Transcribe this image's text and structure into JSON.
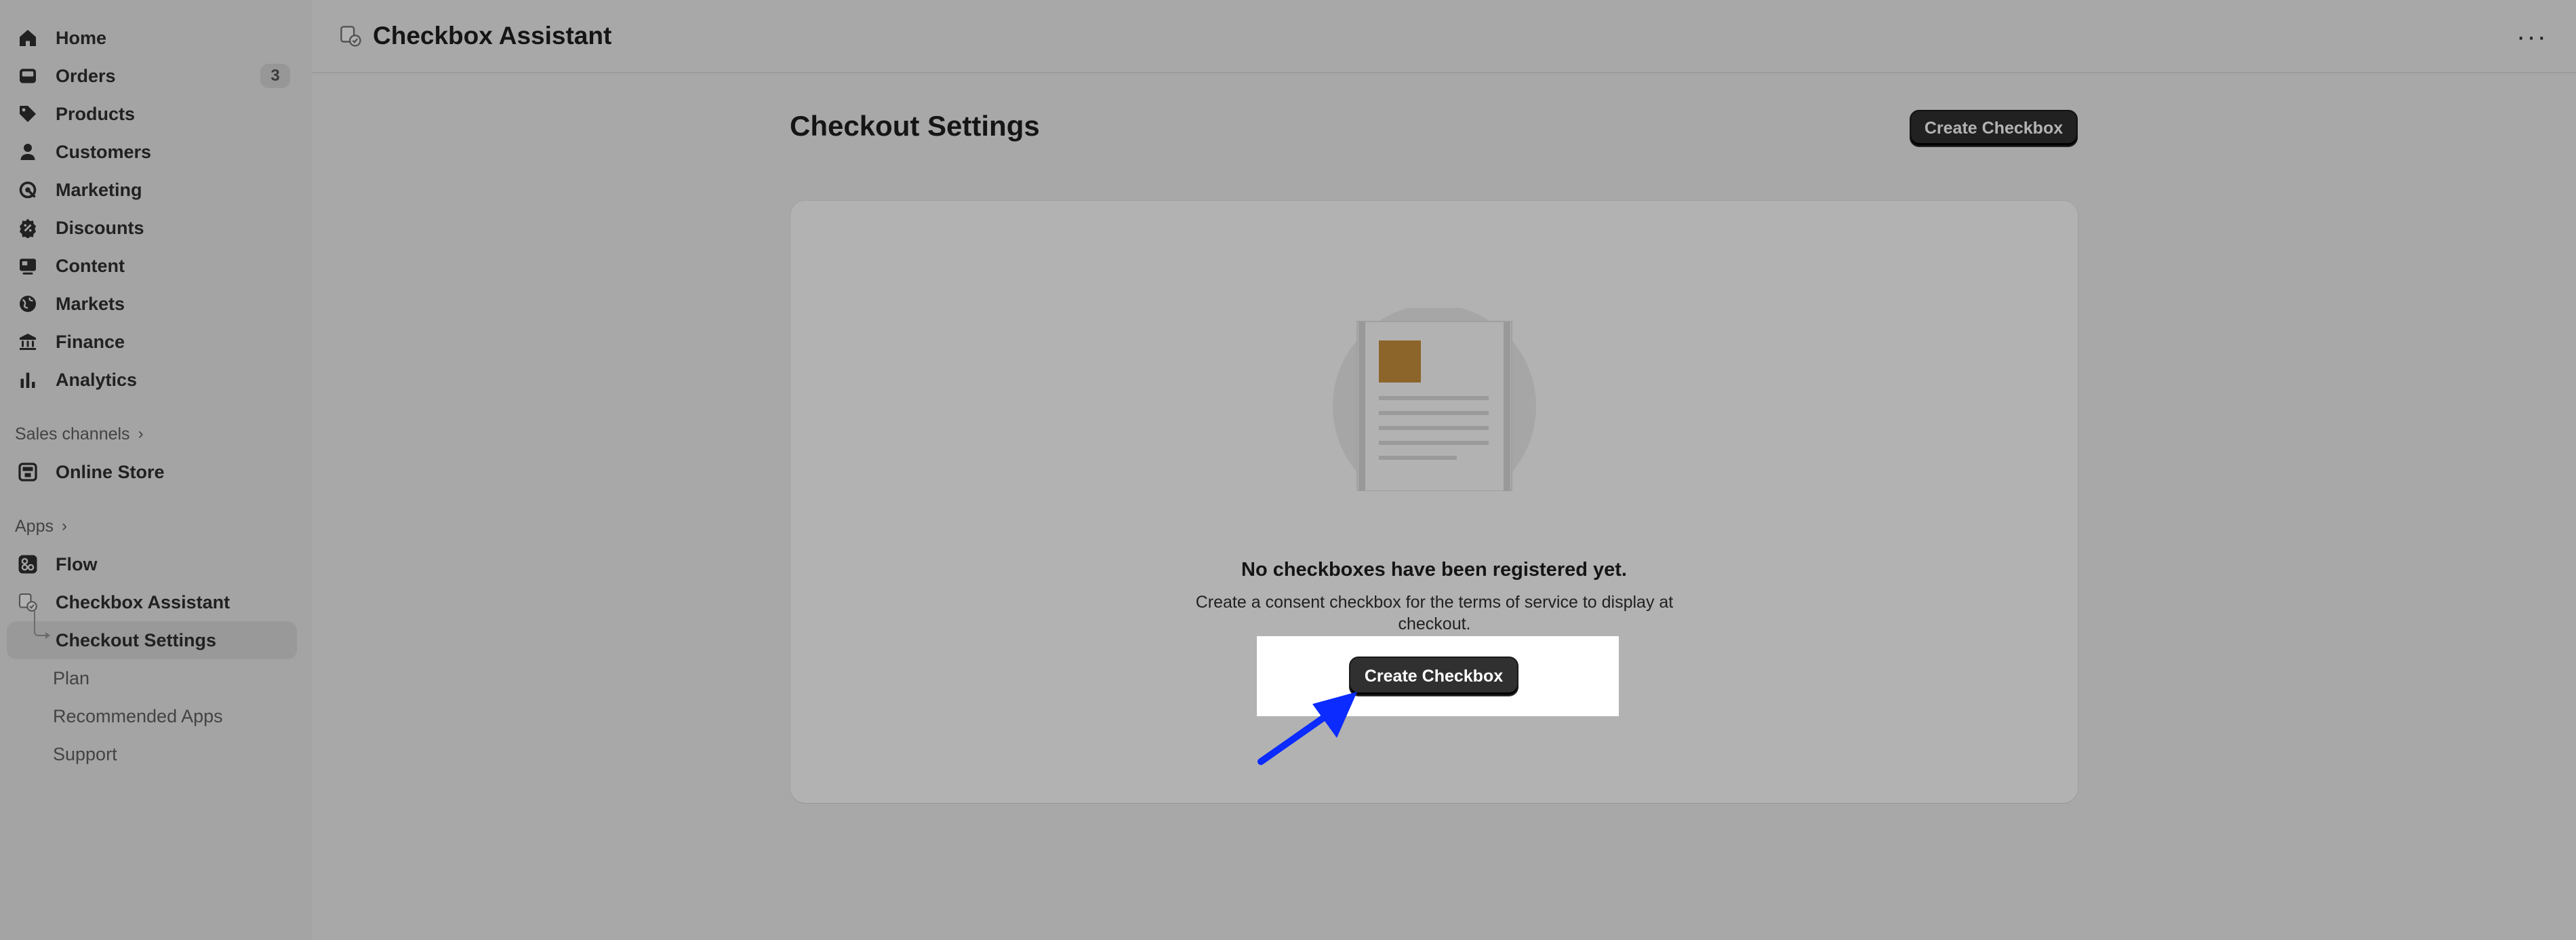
{
  "sidebar": {
    "items": [
      {
        "label": "Home",
        "icon": "home-icon"
      },
      {
        "label": "Orders",
        "icon": "orders-icon",
        "badge": "3"
      },
      {
        "label": "Products",
        "icon": "tag-icon"
      },
      {
        "label": "Customers",
        "icon": "person-icon"
      },
      {
        "label": "Marketing",
        "icon": "target-icon"
      },
      {
        "label": "Discounts",
        "icon": "discount-icon"
      },
      {
        "label": "Content",
        "icon": "content-icon"
      },
      {
        "label": "Markets",
        "icon": "globe-icon"
      },
      {
        "label": "Finance",
        "icon": "bank-icon"
      },
      {
        "label": "Analytics",
        "icon": "bar-chart-icon"
      }
    ],
    "sales_channels_label": "Sales channels",
    "online_store": "Online Store",
    "apps_label": "Apps",
    "apps": {
      "flow": "Flow",
      "checkbox_assistant": "Checkbox Assistant",
      "checkout_settings": "Checkout Settings",
      "plan": "Plan",
      "recommended_apps": "Recommended Apps",
      "support": "Support"
    }
  },
  "header": {
    "app_title": "Checkbox Assistant",
    "more_label": "···"
  },
  "main": {
    "page_title": "Checkout Settings",
    "create_button_label": "Create Checkbox",
    "empty_state": {
      "heading": "No checkboxes have been registered yet.",
      "description": "Create a consent checkbox for the terms of service to display at checkout.",
      "button_label": "Create Checkbox"
    }
  },
  "colors": {
    "primary_button": "#303030",
    "sidebar_bg": "#ebebeb",
    "page_bg": "#f1f1f1",
    "arrow": "#0b2bff",
    "illustration_accent": "#c9913d"
  }
}
